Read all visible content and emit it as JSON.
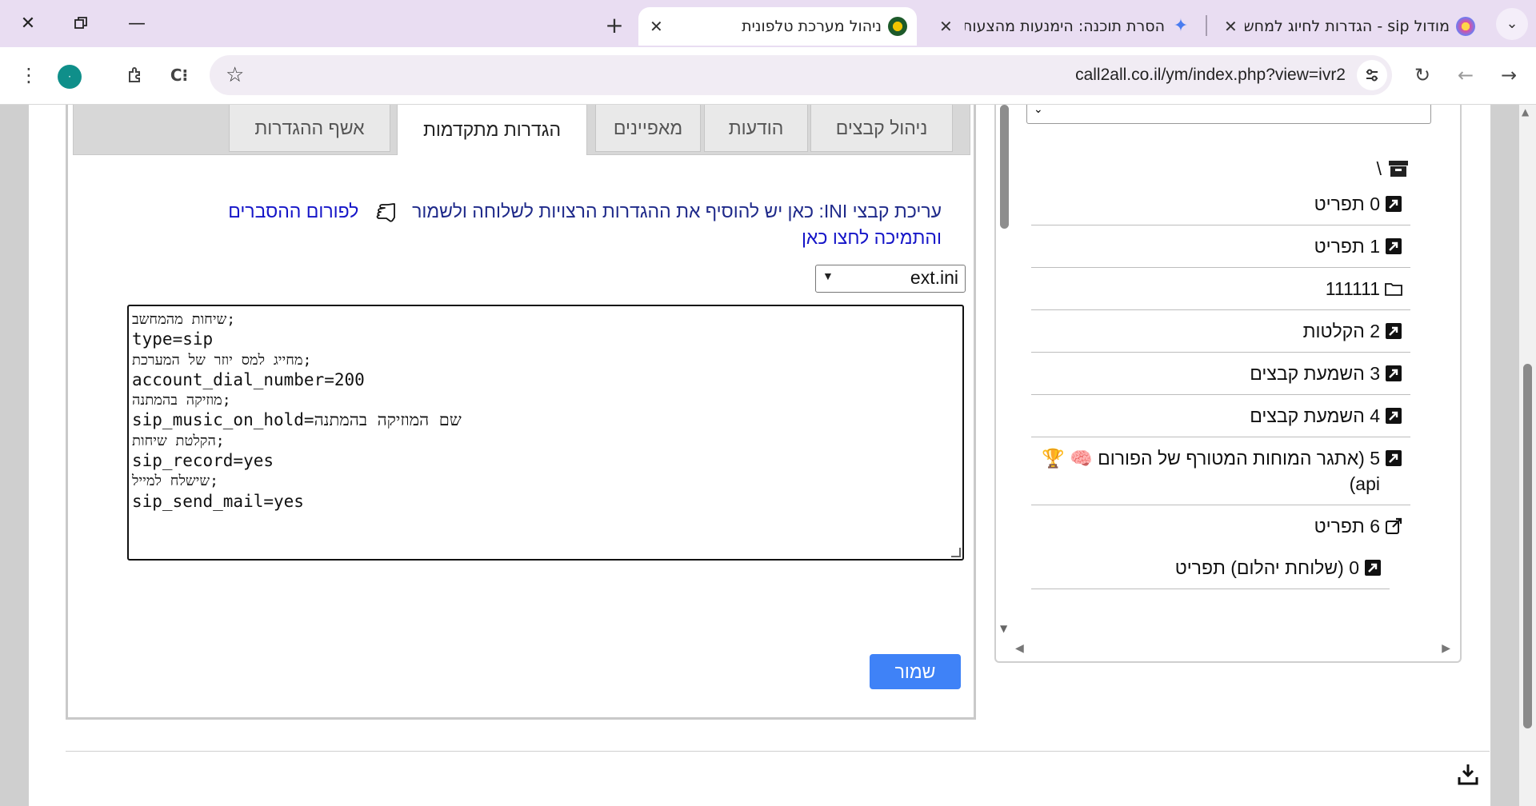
{
  "browser": {
    "tabs": [
      {
        "title": "מודול sip - הגדרות לחיוג למחשב",
        "active": false
      },
      {
        "title": "הסרת תוכנה: הימנעות מהצעות",
        "active": false
      },
      {
        "title": "ניהול מערכת טלפונית",
        "active": true
      }
    ],
    "url": "call2all.co.il/ym/index.php?view=ivr2",
    "profile_initial": "·",
    "tab_close_glyph": "✕"
  },
  "main": {
    "tabs": [
      {
        "label": "ניהול קבצים"
      },
      {
        "label": "הודעות"
      },
      {
        "label": "מאפיינים"
      },
      {
        "label": "הגדרות מתקדמות",
        "active": true
      },
      {
        "label": "אשף ההגדרות"
      }
    ],
    "ini_heading": "עריכת קבצי INI: כאן יש להוסיף את ההגדרות הרצויות לשלוחה ולשמור",
    "ini_help_link": "לפורום ההסברים והתמיכה לחצו כאן",
    "file_selected": "ext.ini",
    "editor_lines": [
      ";שיחות מהמחשב",
      "type=sip",
      ";מחייג למס יוזר של המערכת",
      "account_dial_number=200",
      ";מוזיקה בהמתנה",
      "sip_music_on_hold=שם המוזיקה בהמתנה",
      ";הקלטת שיחות",
      "sip_record=yes",
      ";שישלח למייל",
      "sip_send_mail=yes"
    ],
    "save_label": "שמור"
  },
  "tree": {
    "root_label": "\\",
    "items": [
      {
        "label": "0 תפריט",
        "icon": "shortcut-icon"
      },
      {
        "label": "1 תפריט",
        "icon": "shortcut-icon"
      },
      {
        "label": "111111",
        "icon": "folder-icon"
      },
      {
        "label": "2 הקלטות",
        "icon": "shortcut-icon"
      },
      {
        "label": "3 השמעת קבצים",
        "icon": "shortcut-icon"
      },
      {
        "label": "4 השמעת קבצים",
        "icon": "shortcut-icon"
      },
      {
        "label": "5 (אתגר המוחות המטורף של הפורום 🧠 🏆 api)",
        "icon": "shortcut-icon"
      },
      {
        "label": "6 תפריט",
        "icon": "external-link-icon"
      },
      {
        "label": "0 (שלוחת יהלום) תפריט",
        "icon": "shortcut-icon"
      }
    ]
  },
  "colors": {
    "accent": "#3f82f7",
    "tab_bar": "#e9ddf2",
    "link": "#1515c8",
    "heading": "#1f2a8a"
  }
}
